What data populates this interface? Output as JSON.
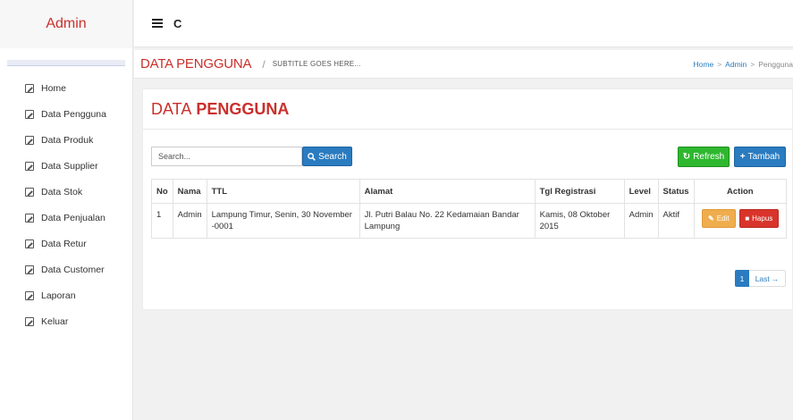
{
  "sidebar": {
    "brand": "Admin",
    "items": [
      {
        "label": "Home"
      },
      {
        "label": "Data Pengguna"
      },
      {
        "label": "Data Produk"
      },
      {
        "label": "Data Supplier"
      },
      {
        "label": "Data Stok"
      },
      {
        "label": "Data Penjualan"
      },
      {
        "label": "Data Retur"
      },
      {
        "label": "Data Customer"
      },
      {
        "label": "Laporan"
      },
      {
        "label": "Keluar"
      }
    ],
    "item_icon": "edit-icon"
  },
  "topbar": {
    "menu_icon": "hamburger-icon",
    "refresh_glyph": "C"
  },
  "pagehead": {
    "title": "DATA PENGGUNA",
    "separator": "/",
    "subtitle": "SUBTITLE GOES HERE...",
    "breadcrumb": {
      "home": "Home",
      "admin": "Admin",
      "current": "Pengguna",
      "chevron": ">"
    }
  },
  "panel": {
    "title_prefix": "DATA",
    "title_bold": "PENGGUNA",
    "search_placeholder": "Search...",
    "search_label": "Search",
    "refresh_label": "Refresh",
    "tambah_label": "Tambah",
    "columns": [
      "No",
      "Nama",
      "TTL",
      "Alamat",
      "Tgl Registrasi",
      "Level",
      "Status",
      "Action"
    ],
    "rows": [
      {
        "no": "1",
        "nama": "Admin",
        "ttl": "Lampung Timur, Senin, 30 November -0001",
        "alamat": "Jl. Putri Balau No. 22 Kedamaian Bandar Lampung",
        "tgl": "Kamis, 08 Oktober 2015",
        "level": "Admin",
        "status": "Aktif",
        "edit_label": "Edit",
        "hapus_label": "Hapus"
      }
    ],
    "pagination": {
      "current": "1",
      "last_label": "Last"
    }
  },
  "colors": {
    "brand_red": "#c9302c",
    "primary_blue": "#2a7bc0",
    "success_green": "#2eb82e",
    "warning_orange": "#f0ad4e",
    "danger_red": "#d9342b"
  }
}
